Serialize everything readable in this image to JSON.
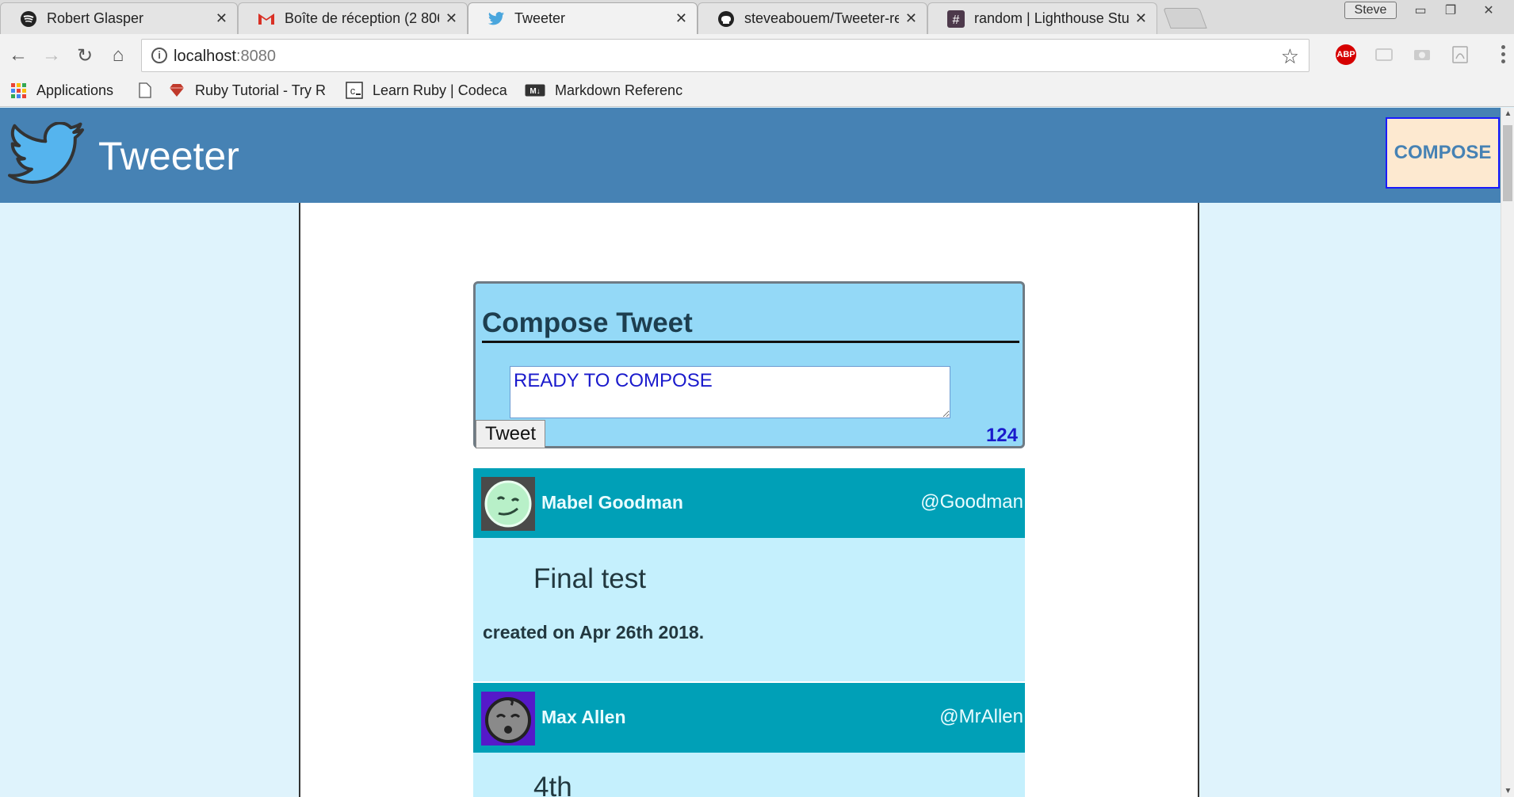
{
  "browser": {
    "tabs": [
      {
        "title": "Robert Glasper",
        "icon": "spotify-icon",
        "active": false
      },
      {
        "title": "Boîte de réception (2 806",
        "icon": "gmail-icon",
        "active": false
      },
      {
        "title": "Tweeter",
        "icon": "twitter-icon",
        "active": true
      },
      {
        "title": "steveabouem/Tweeter-re",
        "icon": "github-icon",
        "active": false
      },
      {
        "title": "random | Lighthouse Stuc",
        "icon": "slack-icon",
        "active": false
      }
    ],
    "profile_name": "Steve",
    "url_host": "localhost",
    "url_port": ":8080",
    "bookmarks": [
      {
        "label": "Applications",
        "icon": "apps-grid-icon"
      },
      {
        "label": "",
        "icon": "page-icon"
      },
      {
        "label": "Ruby Tutorial - Try R",
        "icon": "ruby-icon"
      },
      {
        "label": "Learn Ruby | Codeca",
        "icon": "codecademy-icon"
      },
      {
        "label": "Markdown Referenc",
        "icon": "markdown-icon"
      }
    ],
    "abp_label": "ABP"
  },
  "app": {
    "title": "Tweeter",
    "compose_button": "COMPOSE",
    "accent_color": "#4682b4"
  },
  "compose": {
    "heading": "Compose Tweet",
    "textarea_value": "READY TO COMPOSE",
    "submit_label": "Tweet",
    "counter": "124"
  },
  "tweets": [
    {
      "name": "Mabel Goodman",
      "handle": "@Goodman",
      "text": "Final test",
      "date": "created on Apr 26th 2018."
    },
    {
      "name": "Max Allen",
      "handle": "@MrAllen",
      "text": "4th",
      "date": ""
    }
  ]
}
